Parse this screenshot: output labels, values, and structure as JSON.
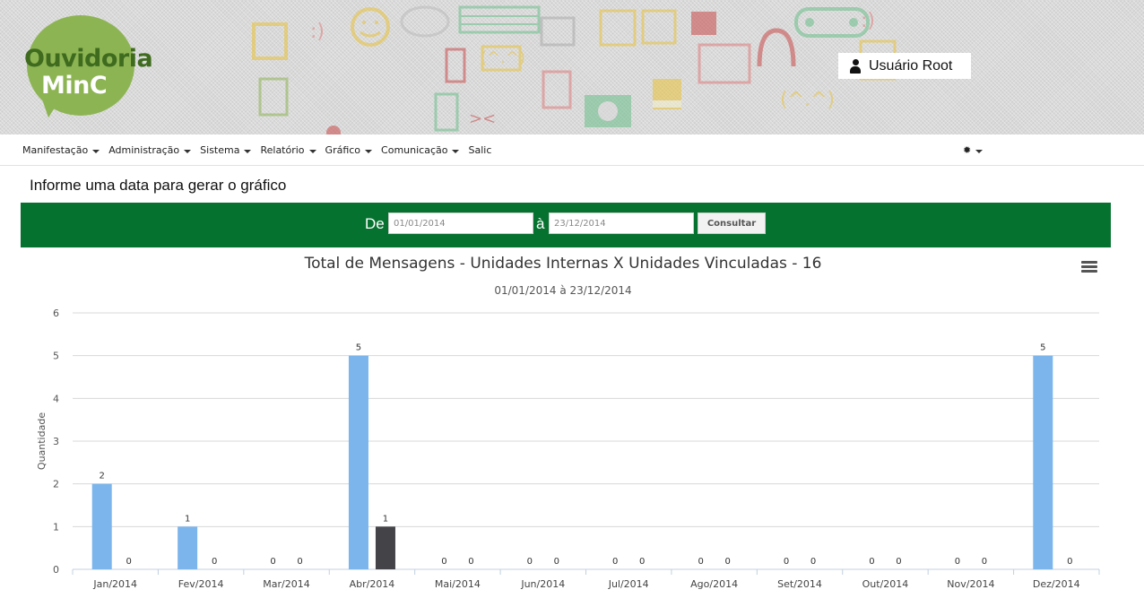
{
  "header": {
    "logo_line1": "Ouvidoria",
    "logo_line2": "MinC",
    "user_name": "Usuário Root",
    "user_icon": "user-icon"
  },
  "nav": {
    "items": [
      {
        "label": "Manifestação",
        "dropdown": true
      },
      {
        "label": "Administração",
        "dropdown": true
      },
      {
        "label": "Sistema",
        "dropdown": true
      },
      {
        "label": "Relatório",
        "dropdown": true
      },
      {
        "label": "Gráfico",
        "dropdown": true
      },
      {
        "label": "Comunicação",
        "dropdown": true
      },
      {
        "label": "Salic",
        "dropdown": false
      }
    ],
    "settings_icon": "gear-icon"
  },
  "form": {
    "title": "Informe uma data para gerar o gráfico",
    "label_from": "De",
    "label_to": "à",
    "date_from": "01/01/2014",
    "date_to": "23/12/2014",
    "submit_label": "Consultar",
    "bar_color": "#06722f"
  },
  "chart_data": {
    "type": "bar",
    "title": "Total de Mensagens - Unidades Internas X Unidades Vinculadas - 16",
    "subtitle": "01/01/2014 à 23/12/2014",
    "ylabel": "Quantidade",
    "xlabel": "",
    "ylim": [
      0,
      6
    ],
    "yticks": [
      0,
      1,
      2,
      3,
      4,
      5,
      6
    ],
    "grid": true,
    "categories": [
      "Jan/2014",
      "Fev/2014",
      "Mar/2014",
      "Abr/2014",
      "Mai/2014",
      "Jun/2014",
      "Jul/2014",
      "Ago/2014",
      "Set/2014",
      "Out/2014",
      "Nov/2014",
      "Dez/2014"
    ],
    "series": [
      {
        "color": "#7cb5ec",
        "values": [
          2,
          1,
          0,
          5,
          0,
          0,
          0,
          0,
          0,
          0,
          0,
          5
        ]
      },
      {
        "color": "#434348",
        "values": [
          0,
          0,
          0,
          1,
          0,
          0,
          0,
          0,
          0,
          0,
          0,
          0
        ]
      }
    ],
    "data_labels": true,
    "menu_icon": "hamburger-menu-icon"
  }
}
